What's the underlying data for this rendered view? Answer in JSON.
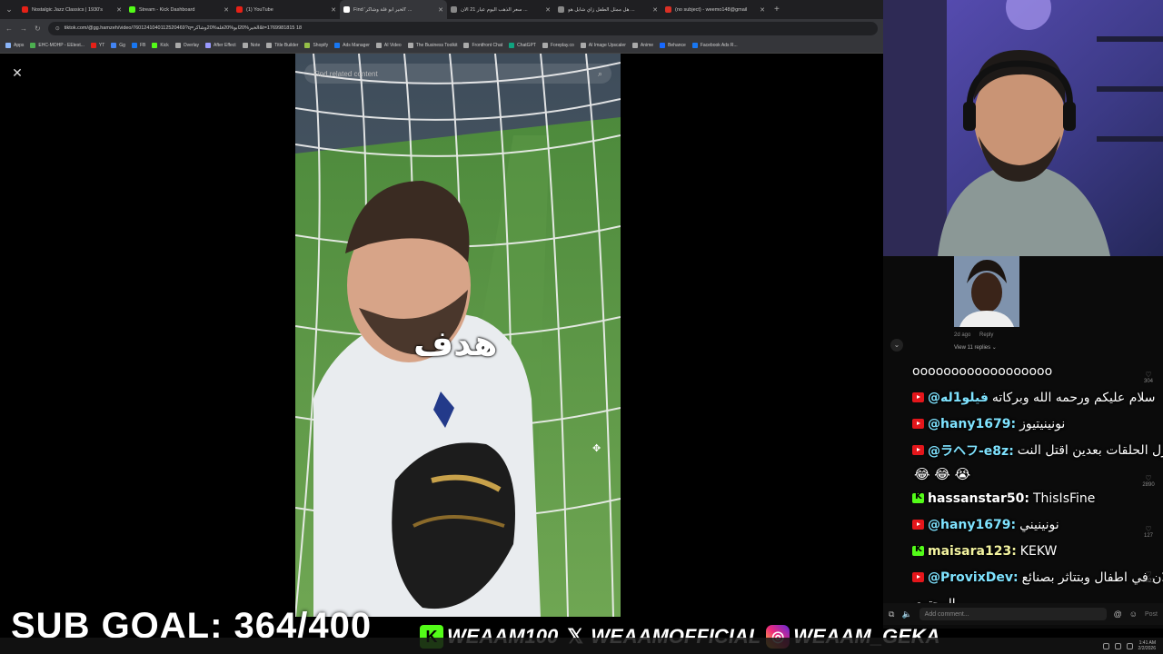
{
  "browser": {
    "tabs": [
      {
        "title": "Nostalgic Jazz Classics | 1930's",
        "color": "#e62117",
        "active": false
      },
      {
        "title": "Stream - Kick Dashboard",
        "color": "#53fc18",
        "active": false
      },
      {
        "title": "(1) YouTube",
        "color": "#e62117",
        "active": false
      },
      {
        "title": "Find 'الخير ابو فلة وشاكر' ...",
        "color": "#ffffff",
        "active": true
      },
      {
        "title": "سعر الذهب اليوم عيار 21 الآن ...",
        "color": "#888888",
        "active": false
      },
      {
        "title": "هل ممثل الطفل زاي شايل هو ...",
        "color": "#888888",
        "active": false
      },
      {
        "title": "(no subject) - weemo148@gmail",
        "color": "#d93025",
        "active": false
      }
    ],
    "url": "tiktok.com/@gg.hamzeh/video/7601241040112520469?q=الخير%20ابو%20فلة%20وشاكر&t=1769981815 18",
    "bookmarks": [
      {
        "label": "Apps",
        "color": "#8ab4f8"
      },
      {
        "label": "EHC-MOHP - EEtest...",
        "color": "#4caf50"
      },
      {
        "label": "YT",
        "color": "#e62117"
      },
      {
        "label": "Gg",
        "color": "#4285f4"
      },
      {
        "label": "FB",
        "color": "#1877f2"
      },
      {
        "label": "Kick",
        "color": "#53fc18"
      },
      {
        "label": "Overlay",
        "color": "#aaaaaa"
      },
      {
        "label": "After Effect",
        "color": "#9999ff"
      },
      {
        "label": "Note",
        "color": "#aaaaaa"
      },
      {
        "label": "Title Builder",
        "color": "#aaaaaa"
      },
      {
        "label": "Shopify",
        "color": "#95bf47"
      },
      {
        "label": "Ads Manager",
        "color": "#1877f2"
      },
      {
        "label": "AI Video",
        "color": "#aaaaaa"
      },
      {
        "label": "The Business Toolkit",
        "color": "#aaaaaa"
      },
      {
        "label": "Frontfront Chat",
        "color": "#aaaaaa"
      },
      {
        "label": "ChatGPT",
        "color": "#10a37f"
      },
      {
        "label": "Foreplay.co",
        "color": "#aaaaaa"
      },
      {
        "label": "AI Image Upscaler",
        "color": "#aaaaaa"
      },
      {
        "label": "Anime",
        "color": "#aaaaaa"
      },
      {
        "label": "Behance",
        "color": "#1769ff"
      },
      {
        "label": "Facebook Ads R...",
        "color": "#1877f2"
      }
    ]
  },
  "tiktok": {
    "search_placeholder": "Find related content",
    "overlay_word": "هدف",
    "comment": {
      "age": "2d ago",
      "reply": "Reply",
      "view_replies": "View 11 replies"
    },
    "likes": [
      "304",
      "2890",
      "127",
      "5022"
    ],
    "comment_placeholder": "Add comment...",
    "post_label": "Post"
  },
  "chat": [
    {
      "platform": "none",
      "user": "",
      "message": "oooooooooooooooooo"
    },
    {
      "platform": "yt",
      "user": "@فيلو1له",
      "message": "سلام عليكم ورحمه الله وبركاته",
      "color": "#7fe3ff"
    },
    {
      "platform": "yt",
      "user": "@hany1679:",
      "message": "نونينيتيوز",
      "color": "#7fe3ff"
    },
    {
      "platform": "yt",
      "user": "@ラヘフ-e8z:",
      "message": "انا بنزل الحلقات بعدين اقتل النت",
      "color": "#7fe3ff"
    },
    {
      "platform": "emoji",
      "user": "",
      "message": "😂 😂 😭"
    },
    {
      "platform": "kick",
      "user": "hassanstar50:",
      "message": "ThisIsFine",
      "color": "#ffffff"
    },
    {
      "platform": "yt",
      "user": "@hany1679:",
      "message": "نونينيني",
      "color": "#7fe3ff"
    },
    {
      "platform": "kick",
      "user": "maisara123:",
      "message": "KEKW",
      "color": "#f4f4a0"
    },
    {
      "platform": "yt",
      "user": "@ProvixDev:",
      "message": "لان في اطفال وبتتاثر بصنائع",
      "color": "#7fe3ff"
    },
    {
      "platform": "none",
      "user": "",
      "message": "المحتوي"
    }
  ],
  "overlay": {
    "sub_goal": "SUB GOAL: 364/400",
    "socials": [
      {
        "icon": "K",
        "kind": "kick",
        "handle": "WEAAM100"
      },
      {
        "icon": "𝕏",
        "kind": "x",
        "handle": "WEAAMOFFICIAL"
      },
      {
        "icon": "◎",
        "kind": "ig",
        "handle": "WEAAM_GEKA"
      }
    ]
  },
  "taskbar": {
    "time": "1:41 AM",
    "date": "2/2/2026"
  }
}
